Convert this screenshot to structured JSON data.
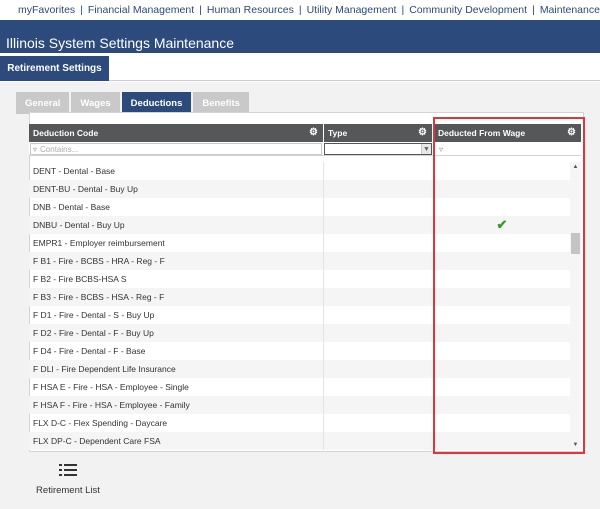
{
  "topnav": {
    "items": [
      "myFavorites",
      "Financial Management",
      "Human Resources",
      "Utility Management",
      "Community Development",
      "Maintenance"
    ],
    "separator": "|"
  },
  "app": {
    "title": "Illinois System Settings Maintenance"
  },
  "subtab": {
    "label": "Retirement Settings"
  },
  "tabs": [
    {
      "label": "General",
      "active": false
    },
    {
      "label": "Wages",
      "active": false
    },
    {
      "label": "Deductions",
      "active": true
    },
    {
      "label": "Benefits",
      "active": false
    }
  ],
  "grid": {
    "columns": [
      {
        "label": "Deduction Code"
      },
      {
        "label": "Type"
      },
      {
        "label": "Deducted From Wage"
      }
    ],
    "filter_placeholder": "Contains...",
    "rows": [
      {
        "code": "DENT - Dental - Base",
        "deducted": false
      },
      {
        "code": "DENT-BU - Dental - Buy Up",
        "deducted": false
      },
      {
        "code": "DNB - Dental - Base",
        "deducted": false
      },
      {
        "code": "DNBU - Dental - Buy Up",
        "deducted": true
      },
      {
        "code": "EMPR1 - Employer reimbursement",
        "deducted": false
      },
      {
        "code": "F B1 - Fire - BCBS - HRA - Reg - F",
        "deducted": false
      },
      {
        "code": "F B2 - Fire BCBS-HSA S",
        "deducted": false
      },
      {
        "code": "F B3 - Fire - BCBS - HSA - Reg - F",
        "deducted": false
      },
      {
        "code": "F D1 - Fire - Dental - S - Buy Up",
        "deducted": false
      },
      {
        "code": "F D2 - Fire - Dental - F - Buy Up",
        "deducted": false
      },
      {
        "code": "F D4 - Fire - Dental - F - Base",
        "deducted": false
      },
      {
        "code": "F DLI - Fire Dependent Life Insurance",
        "deducted": false
      },
      {
        "code": "F HSA E - Fire - HSA - Employee - Single",
        "deducted": false
      },
      {
        "code": "F HSA F - Fire - HSA - Employee - Family",
        "deducted": false
      },
      {
        "code": "FLX D-C - Flex Spending - Daycare",
        "deducted": false
      },
      {
        "code": "FLX DP-C - Dependent Care FSA",
        "deducted": false
      }
    ]
  },
  "footer": {
    "list_label": "Retirement List"
  },
  "colors": {
    "brand": "#2c4a7c",
    "header": "#555759",
    "check": "#3a9a2a",
    "highlight": "#e0353a"
  }
}
